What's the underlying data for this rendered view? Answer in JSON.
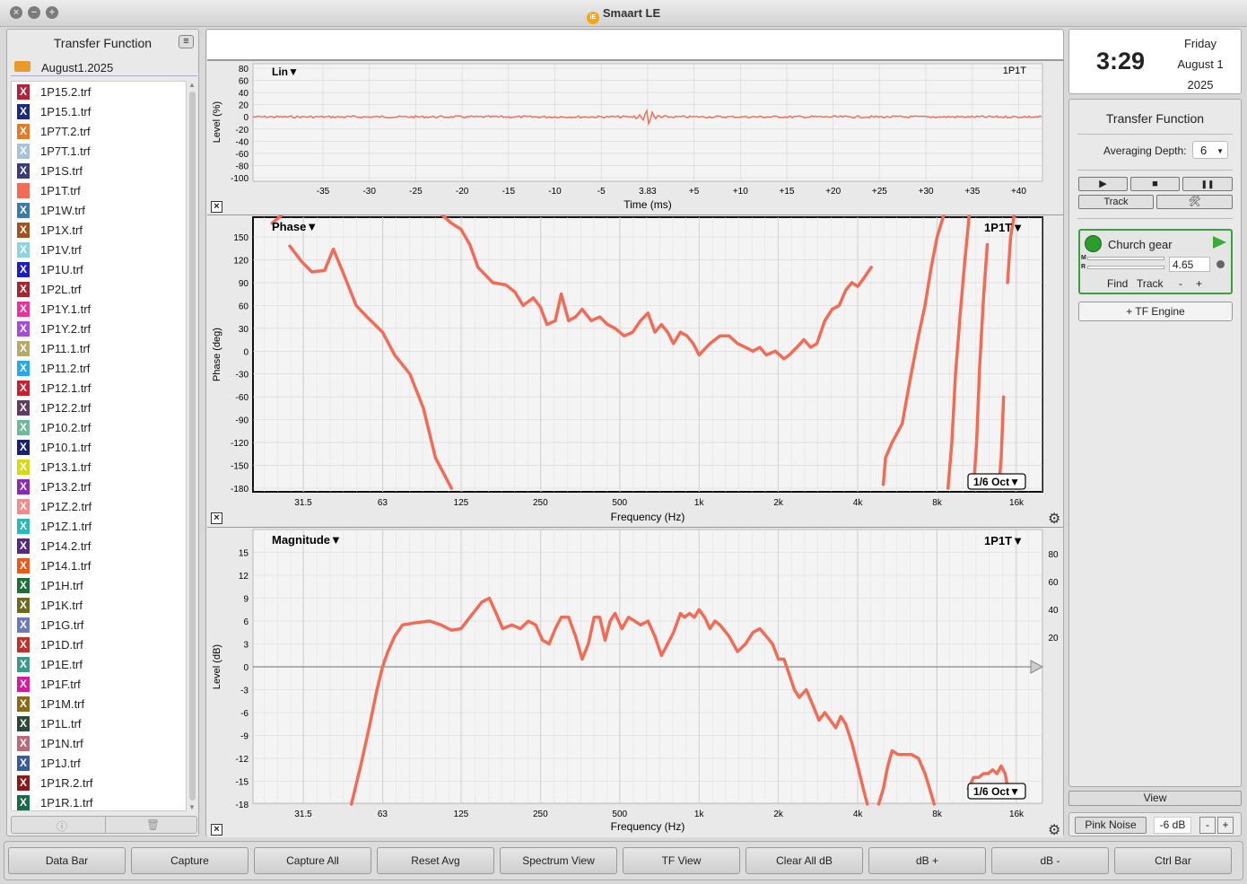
{
  "app": {
    "title": "Smaart LE",
    "icon_glyph": "iE"
  },
  "window_controls": {
    "close": "×",
    "minimize": "−",
    "zoom": "+"
  },
  "sidebar": {
    "title": "Transfer Function",
    "menu_glyph": "≡",
    "folder": "August1.2025",
    "files": [
      {
        "name": "1P15.2.trf",
        "color": "#b0233a",
        "glyph": "X"
      },
      {
        "name": "1P15.1.trf",
        "color": "#1d2a7a",
        "glyph": "X"
      },
      {
        "name": "1P7T.2.trf",
        "color": "#e07b27",
        "glyph": "X"
      },
      {
        "name": "1P7T.1.trf",
        "color": "#a6c2dc",
        "glyph": "X"
      },
      {
        "name": "1P1S.trf",
        "color": "#3c3b7a",
        "glyph": "X"
      },
      {
        "name": "1P1T.trf",
        "color": "#f26b56",
        "glyph": ""
      },
      {
        "name": "1P1W.trf",
        "color": "#3f79a6",
        "glyph": "X"
      },
      {
        "name": "1P1X.trf",
        "color": "#a0521f",
        "glyph": "X"
      },
      {
        "name": "1P1V.trf",
        "color": "#8fd3e0",
        "glyph": "X"
      },
      {
        "name": "1P1U.trf",
        "color": "#1c1cc2",
        "glyph": "X"
      },
      {
        "name": "1P2L.trf",
        "color": "#a2262f",
        "glyph": "X"
      },
      {
        "name": "1P1Y.1.trf",
        "color": "#e8339a",
        "glyph": "X"
      },
      {
        "name": "1P1Y.2.trf",
        "color": "#a64bd6",
        "glyph": "X"
      },
      {
        "name": "1P11.1.trf",
        "color": "#b5a96b",
        "glyph": "X"
      },
      {
        "name": "1P11.2.trf",
        "color": "#26a9e6",
        "glyph": "X"
      },
      {
        "name": "1P12.1.trf",
        "color": "#c8202e",
        "glyph": "X"
      },
      {
        "name": "1P12.2.trf",
        "color": "#5e3e5e",
        "glyph": "X"
      },
      {
        "name": "1P10.2.trf",
        "color": "#6fb89a",
        "glyph": "X"
      },
      {
        "name": "1P10.1.trf",
        "color": "#1a1f6e",
        "glyph": "X"
      },
      {
        "name": "1P13.1.trf",
        "color": "#d6d91a",
        "glyph": "X"
      },
      {
        "name": "1P13.2.trf",
        "color": "#8b2ab0",
        "glyph": "X"
      },
      {
        "name": "1P1Z.2.trf",
        "color": "#f08c8c",
        "glyph": "X"
      },
      {
        "name": "1P1Z.1.trf",
        "color": "#2bb8b8",
        "glyph": "X"
      },
      {
        "name": "1P14.2.trf",
        "color": "#5a2a7a",
        "glyph": "X"
      },
      {
        "name": "1P14.1.trf",
        "color": "#e85a1a",
        "glyph": "X"
      },
      {
        "name": "1P1H.trf",
        "color": "#1f6e3a",
        "glyph": "X"
      },
      {
        "name": "1P1K.trf",
        "color": "#6b6b20",
        "glyph": "X"
      },
      {
        "name": "1P1G.trf",
        "color": "#6c7ab8",
        "glyph": "X"
      },
      {
        "name": "1P1D.trf",
        "color": "#c2302a",
        "glyph": "X"
      },
      {
        "name": "1P1E.trf",
        "color": "#3a9a8a",
        "glyph": "X"
      },
      {
        "name": "1P1F.trf",
        "color": "#d61a9a",
        "glyph": "X"
      },
      {
        "name": "1P1M.trf",
        "color": "#8a6a1a",
        "glyph": "X"
      },
      {
        "name": "1P1L.trf",
        "color": "#2a4a3a",
        "glyph": "X"
      },
      {
        "name": "1P1N.trf",
        "color": "#b86a7a",
        "glyph": "X"
      },
      {
        "name": "1P1J.trf",
        "color": "#3a5a9a",
        "glyph": "X"
      },
      {
        "name": "1P1R.2.trf",
        "color": "#8a1a1a",
        "glyph": "X"
      },
      {
        "name": "1P1R.1.trf",
        "color": "#1a6a4a",
        "glyph": "X"
      }
    ],
    "scroll_up": "▲",
    "scroll_down": "▼",
    "info_icon": "ⓘ",
    "trash_icon": "🗑"
  },
  "plots": {
    "close_glyph": "×",
    "gear_glyph": "⚙",
    "time": {
      "label": "Lin▼",
      "meas": "1P1T",
      "ylabel": "Level (%)",
      "xlabel": "Time (ms)",
      "yticks": [
        "80",
        "60",
        "40",
        "20",
        "0",
        "-20",
        "-40",
        "-60",
        "-80",
        "-100"
      ],
      "xticks": [
        "-35",
        "-30",
        "-25",
        "-20",
        "-15",
        "-10",
        "-5",
        "3.83",
        "+5",
        "+10",
        "+15",
        "+20",
        "+25",
        "+30",
        "+35",
        "+40"
      ]
    },
    "phase": {
      "label": "Phase▼",
      "meas": "1P1T▼",
      "ylabel": "Phase (deg)",
      "xlabel": "Frequency (Hz)",
      "yticks": [
        "150",
        "120",
        "90",
        "60",
        "30",
        "0",
        "-30",
        "-60",
        "-90",
        "-120",
        "-150",
        "-180"
      ],
      "xticks": [
        "31.5",
        "63",
        "125",
        "250",
        "500",
        "1k",
        "2k",
        "4k",
        "8k",
        "16k"
      ],
      "smoothing": "1/6 Oct▼"
    },
    "magnitude": {
      "label": "Magnitude▼",
      "meas": "1P1T▼",
      "ylabel": "Level (dB)",
      "xlabel": "Frequency (Hz)",
      "yticks": [
        "15",
        "12",
        "9",
        "6",
        "3",
        "0",
        "-3",
        "-6",
        "-9",
        "-12",
        "-15",
        "-18"
      ],
      "yticks_right": [
        "80",
        "60",
        "40",
        "20"
      ],
      "xticks": [
        "31.5",
        "63",
        "125",
        "250",
        "500",
        "1k",
        "2k",
        "4k",
        "8k",
        "16k"
      ],
      "smoothing": "1/6 Oct▼"
    }
  },
  "clock": {
    "time": "3:29",
    "day": "Friday",
    "month_day": "August 1",
    "year": "2025"
  },
  "tf_panel": {
    "title": "Transfer Function",
    "averaging_label": "Averaging Depth:",
    "averaging_value": "6",
    "play_glyph": "▶",
    "stop_glyph": "■",
    "pause_glyph": "❚❚",
    "track_label": "Track",
    "tools_glyph": "🛠",
    "engine": {
      "name": "Church gear",
      "m_label": "M",
      "r_label": "R",
      "value": "4.65",
      "find": "Find",
      "track": "Track",
      "minus": "-",
      "plus": "+"
    },
    "add_engine": "+ TF Engine",
    "view": "View"
  },
  "noise": {
    "label": "Pink Noise",
    "level": "-6 dB",
    "minus": "-",
    "plus": "+"
  },
  "command_bar": [
    "Data Bar",
    "Capture",
    "Capture All",
    "Reset Avg",
    "Spectrum View",
    "TF View",
    "Clear All dB",
    "dB +",
    "dB -",
    "Ctrl Bar"
  ],
  "colors": {
    "trace": "#f26b56",
    "engine_green": "#2e9b2e"
  }
}
